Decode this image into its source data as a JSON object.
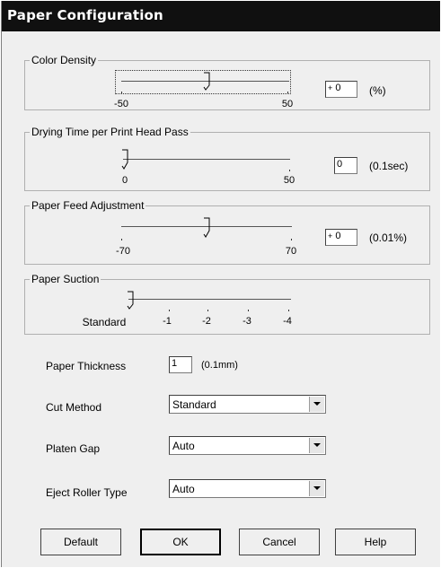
{
  "window": {
    "title": "Paper Configuration"
  },
  "color_density": {
    "label": "Color Density",
    "min_label": "-50",
    "max_label": "50",
    "value": "0",
    "unit": "(%)"
  },
  "drying_time": {
    "label": "Drying Time per Print Head Pass",
    "min_label": "0",
    "max_label": "50",
    "value": "0",
    "unit": "(0.1sec)"
  },
  "paper_feed": {
    "label": "Paper Feed Adjustment",
    "min_label": "-70",
    "max_label": "70",
    "value": "0",
    "unit": "(0.01%)"
  },
  "paper_suction": {
    "label": "Paper Suction",
    "tick_labels": [
      "Standard",
      "-1",
      "-2",
      "-3",
      "-4"
    ]
  },
  "paper_thickness": {
    "label": "Paper Thickness",
    "value": "1",
    "unit": "(0.1mm)"
  },
  "cut_method": {
    "label": "Cut Method",
    "value": "Standard"
  },
  "platen_gap": {
    "label": "Platen Gap",
    "value": "Auto"
  },
  "eject_roller": {
    "label": "Eject Roller Type",
    "value": "Auto"
  },
  "buttons": {
    "default": "Default",
    "ok": "OK",
    "cancel": "Cancel",
    "help": "Help"
  }
}
